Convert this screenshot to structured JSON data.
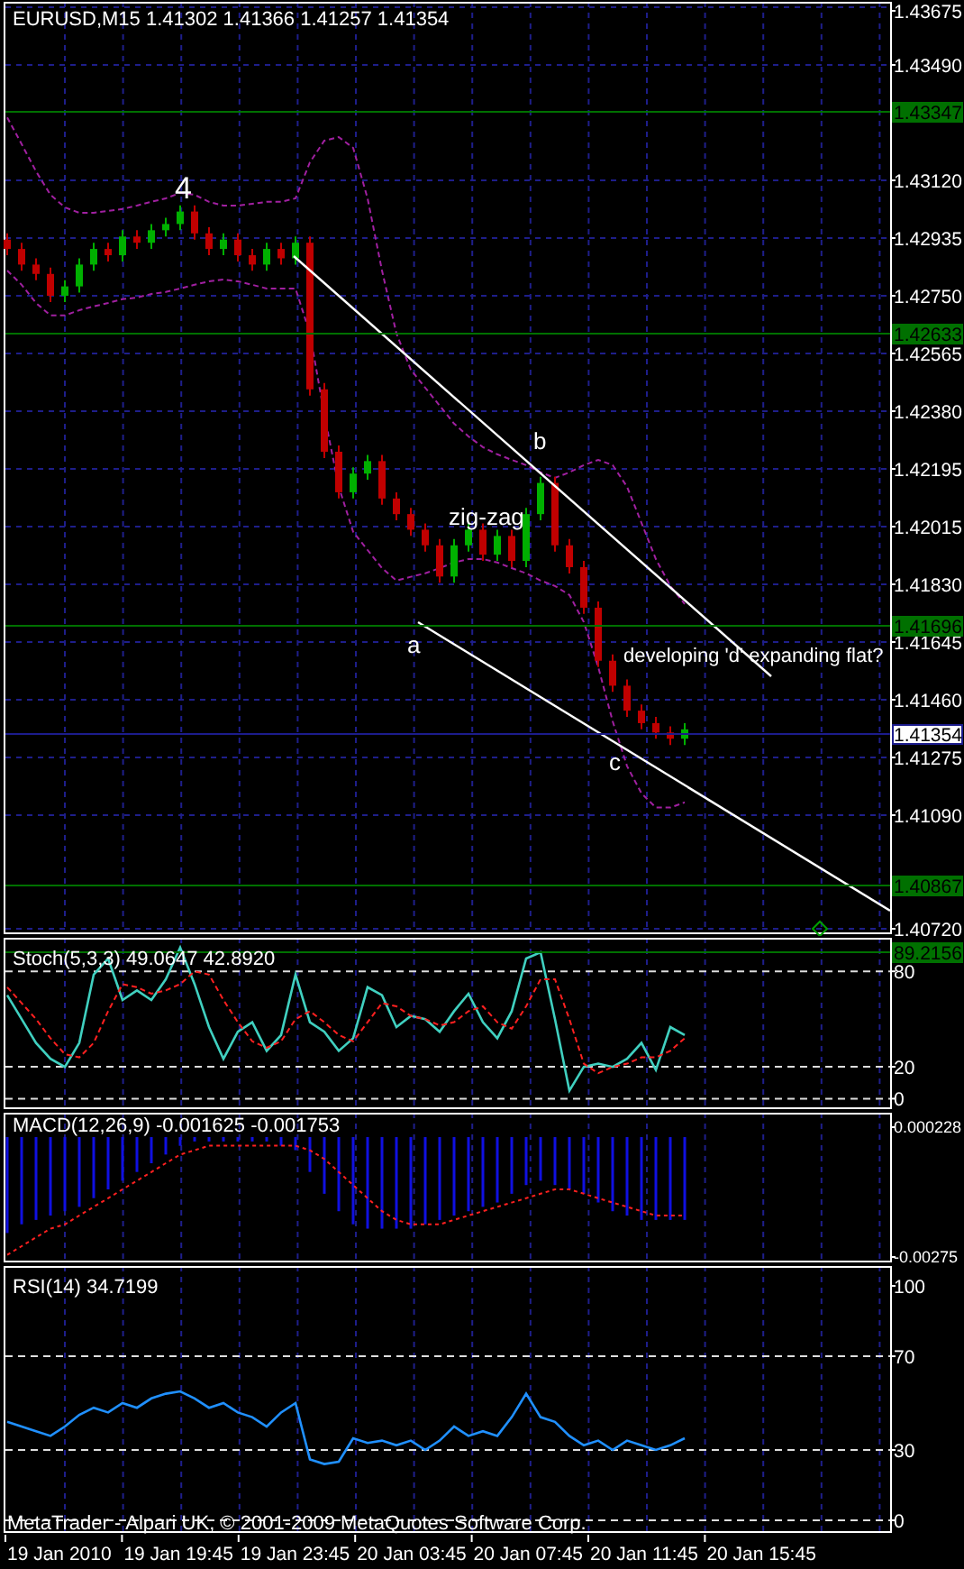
{
  "panels": [
    {
      "kind": "price",
      "header": "EURUSD,M15  1.41302 1.41366 1.41257 1.41354",
      "price_axis": [
        "1.43675",
        "1.43490",
        "1.43120",
        "1.42935",
        "1.42750",
        "1.42565",
        "1.42380",
        "1.42195",
        "1.42015",
        "1.41830",
        "1.41645",
        "1.41460",
        "1.41275",
        "1.41090",
        "1.40720"
      ],
      "levels": [
        {
          "label": "1.43347",
          "color": "#007000"
        },
        {
          "label": "1.42633",
          "color": "#007000"
        },
        {
          "label": "1.41696",
          "color": "#007000"
        },
        {
          "label": "1.41354",
          "color": "#1c1c8c"
        },
        {
          "label": "1.40867",
          "color": "#007000"
        }
      ],
      "notes": [
        "4",
        "b",
        "zig-zag",
        "a",
        "developing 'd' expanding flat?",
        "c"
      ]
    },
    {
      "kind": "stochastic",
      "header": "Stoch(5,3,3) 49.0647 42.8920",
      "chart_data": {
        "type": "line",
        "grid": true,
        "ylim": [
          -6,
          100.5
        ],
        "yticks": [
          0,
          20,
          80
        ],
        "series": [
          {
            "color": "#40d0c0",
            "values": [
              65,
              50,
              35,
              25,
              20,
              35,
              78,
              88,
              62,
              68,
              62,
              75,
              95,
              72,
              45,
              25,
              42,
              48,
              30,
              40,
              78,
              48,
              42,
              30,
              38,
              70,
              65,
              45,
              52,
              50,
              42,
              55,
              66,
              48,
              38,
              55,
              88,
              92,
              50,
              5,
              20,
              22,
              20,
              25,
              35,
              18,
              45,
              40
            ]
          },
          {
            "color": "#ff2020",
            "line_style": "dashed",
            "values": [
              70,
              60,
              50,
              38,
              28,
              26,
              35,
              55,
              72,
              70,
              66,
              68,
              72,
              80,
              78,
              62,
              48,
              36,
              32,
              36,
              50,
              55,
              48,
              40,
              36,
              48,
              60,
              58,
              52,
              50,
              46,
              48,
              55,
              58,
              48,
              44,
              58,
              75,
              75,
              50,
              22,
              16,
              20,
              22,
              26,
              26,
              30,
              38
            ]
          }
        ]
      },
      "levels": [
        {
          "label": "89.2156",
          "color": "#007000"
        }
      ]
    },
    {
      "kind": "macd",
      "header": "MACD(12,26,9) -0.001625 -0.001753",
      "value_axis": [
        "0.000228",
        "-0.00275"
      ]
    },
    {
      "kind": "rsi",
      "header": "RSI(14) 34.7199",
      "footer": "MetaTrader - Alpari UK, © 2001-2009 MetaQuotes Software Corp.",
      "chart_data": {
        "type": "line",
        "grid": true,
        "ylim": [
          -5,
          108.1
        ],
        "yticks": [
          0,
          30,
          70,
          100
        ],
        "series": [
          {
            "color": "#2090ff",
            "values": [
              42,
              40,
              38,
              36,
              40,
              45,
              48,
              46,
              50,
              48,
              52,
              54,
              55,
              52,
              48,
              50,
              46,
              44,
              40,
              46,
              50,
              26,
              24,
              25,
              35,
              33,
              34,
              32,
              34,
              30,
              34,
              40,
              36,
              38,
              36,
              44,
              54,
              44,
              42,
              36,
              32,
              34,
              30,
              34,
              32,
              30,
              32,
              35
            ]
          }
        ]
      }
    }
  ],
  "time_axis": [
    "19 Jan 2010",
    "19 Jan 19:45",
    "19 Jan 23:45",
    "20 Jan 03:45",
    "20 Jan 07:45",
    "20 Jan 11:45",
    "20 Jan 15:45"
  ]
}
